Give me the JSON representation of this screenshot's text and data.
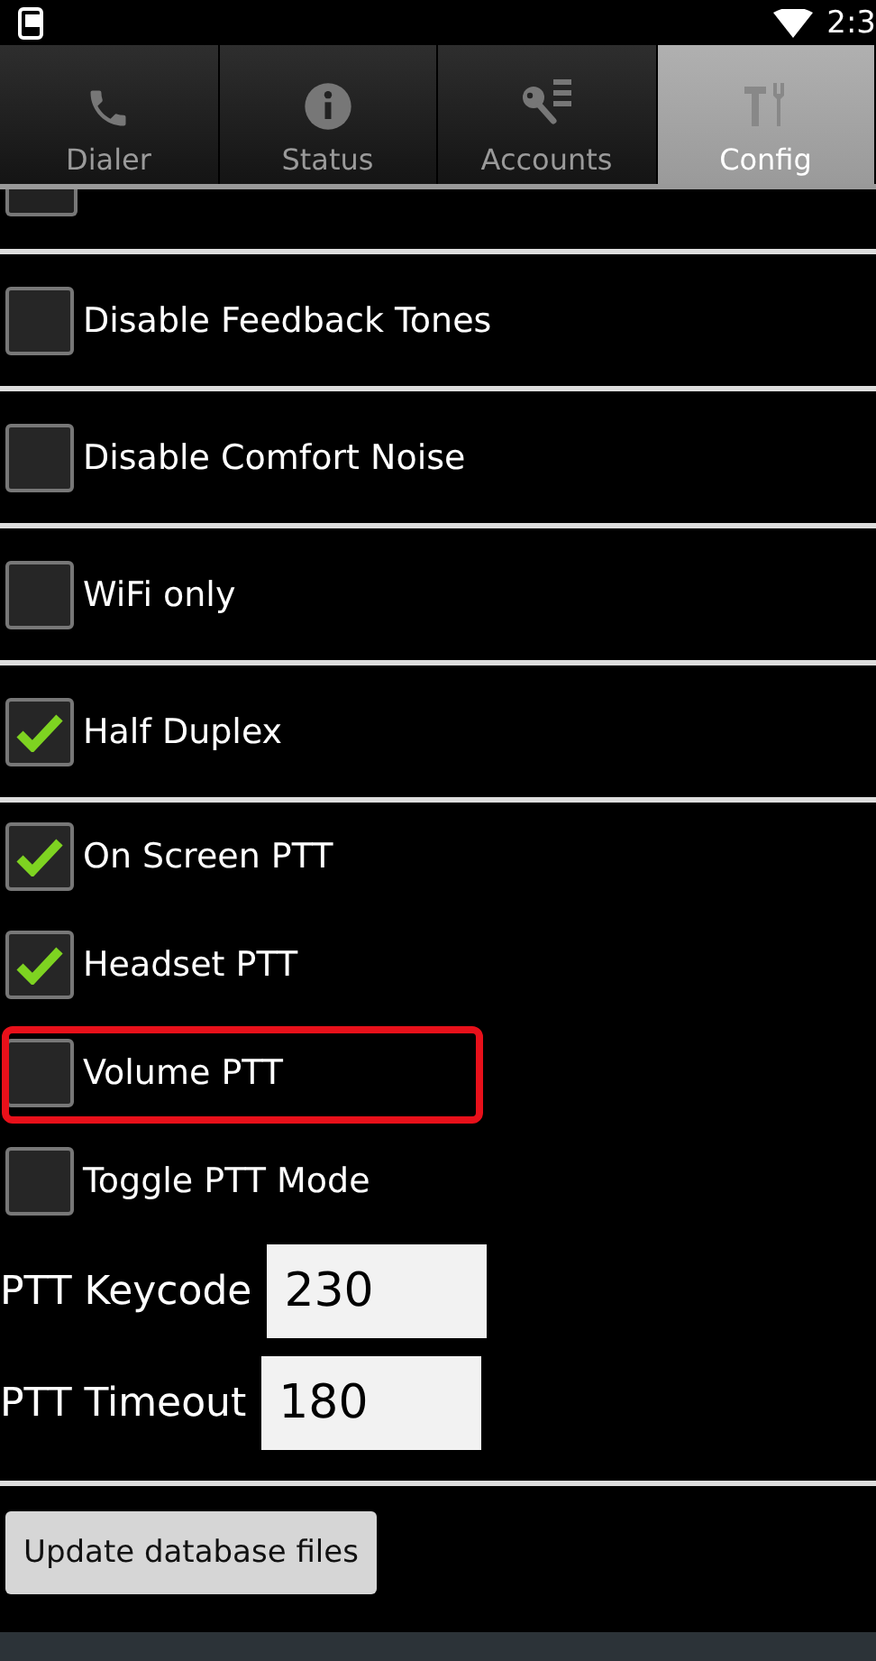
{
  "status_bar": {
    "time": "2:3"
  },
  "tabs": [
    {
      "label": "Dialer",
      "kind": "phone",
      "selected": false
    },
    {
      "label": "Status",
      "kind": "info",
      "selected": false
    },
    {
      "label": "Accounts",
      "kind": "key",
      "selected": false
    },
    {
      "label": "Config",
      "kind": "tools",
      "selected": true
    }
  ],
  "scrolled_item": {
    "checked": false
  },
  "settings": [
    {
      "label": "Disable Feedback Tones",
      "checked": false,
      "divided": true,
      "highlighted": false
    },
    {
      "label": "Disable Comfort Noise",
      "checked": false,
      "divided": true,
      "highlighted": false
    },
    {
      "label": "WiFi only",
      "checked": false,
      "divided": true,
      "highlighted": false
    },
    {
      "label": "Half Duplex",
      "checked": true,
      "divided": true,
      "highlighted": false
    },
    {
      "label": "On Screen PTT",
      "checked": true,
      "divided": false,
      "highlighted": false
    },
    {
      "label": "Headset PTT",
      "checked": true,
      "divided": false,
      "highlighted": false
    },
    {
      "label": "Volume PTT",
      "checked": false,
      "divided": false,
      "highlighted": true
    },
    {
      "label": "Toggle PTT Mode",
      "checked": false,
      "divided": false,
      "highlighted": false
    }
  ],
  "fields": [
    {
      "label": "PTT Keycode",
      "value": "230"
    },
    {
      "label": "PTT Timeout",
      "value": "180"
    }
  ],
  "button": "Update database files"
}
